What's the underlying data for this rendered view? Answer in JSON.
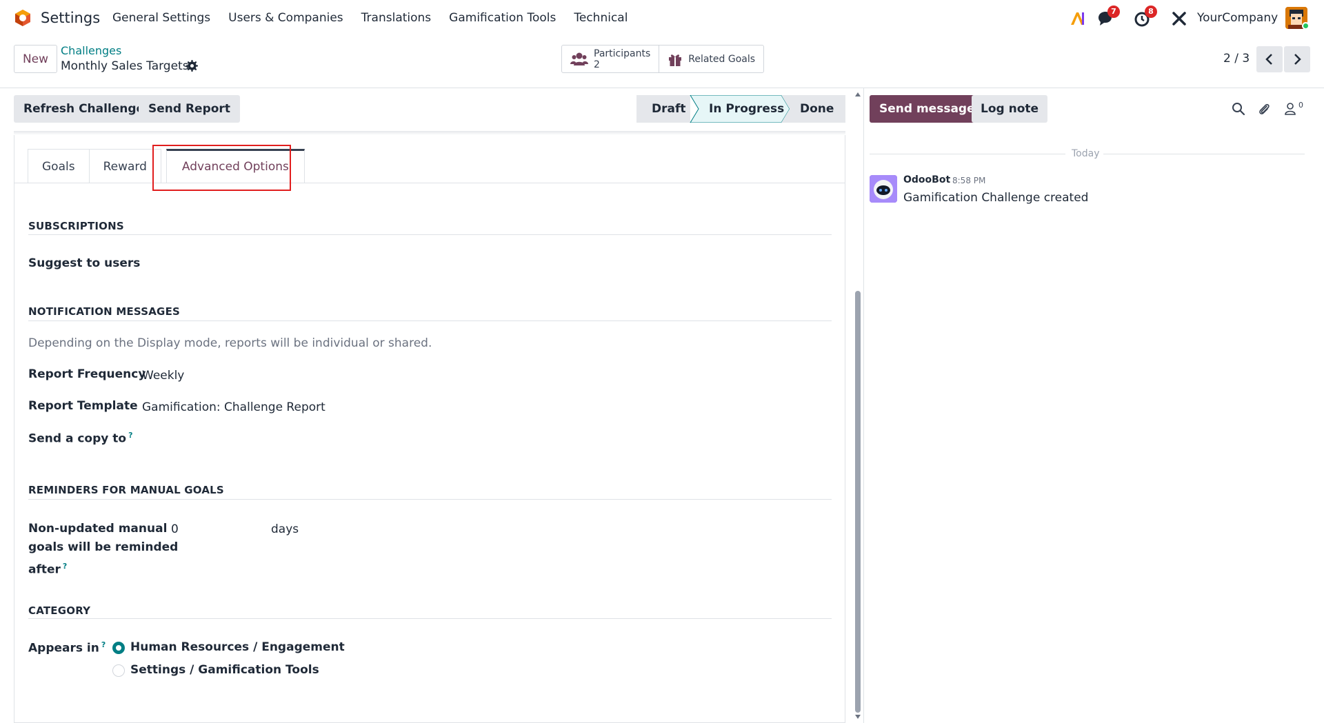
{
  "navbar": {
    "app_name": "Settings",
    "menu": [
      "General Settings",
      "Users & Companies",
      "Translations",
      "Gamification Tools",
      "Technical"
    ],
    "messages_badge": "7",
    "activities_badge": "8",
    "company": "YourCompany",
    "icons": [
      "odoo-logo-icon",
      "ai-icon",
      "chat-icon",
      "clock-icon",
      "tools-icon"
    ]
  },
  "control_panel": {
    "new_label": "New",
    "breadcrumb_parent": "Challenges",
    "breadcrumb_current": "Monthly Sales Targets",
    "smart_buttons": {
      "participants_label": "Participants",
      "participants_count": "2",
      "related_goals_label": "Related Goals"
    },
    "pager": "2 / 3"
  },
  "statusbar": {
    "refresh_label": "Refresh Challenge",
    "send_report_label": "Send Report",
    "stages": [
      "Draft",
      "In Progress",
      "Done"
    ],
    "active_stage": "In Progress"
  },
  "form": {
    "tabs": [
      "Goals",
      "Reward",
      "Advanced Options"
    ],
    "active_tab": "Advanced Options",
    "subscriptions": {
      "title": "SUBSCRIPTIONS",
      "suggest_label": "Suggest to users"
    },
    "notifications": {
      "title": "NOTIFICATION MESSAGES",
      "hint": "Depending on the Display mode, reports will be individual or shared.",
      "frequency_label": "Report Frequency",
      "frequency_value": "Weekly",
      "template_label": "Report Template",
      "template_value": "Gamification: Challenge Report",
      "copy_label": "Send a copy to",
      "help_mark": "?"
    },
    "reminders": {
      "title": "REMINDERS FOR MANUAL GOALS",
      "label_line1": "Non-updated manual",
      "label_line2": "goals will be reminded",
      "label_line3": "after",
      "value": "0",
      "unit": "days"
    },
    "category": {
      "title": "CATEGORY",
      "appears_label": "Appears in",
      "options": [
        "Human Resources / Engagement",
        "Settings / Gamification Tools"
      ],
      "selected": "Human Resources / Engagement"
    }
  },
  "chatter": {
    "send_message_label": "Send message",
    "log_note_label": "Log note",
    "follower_count": "0",
    "date_separator": "Today",
    "messages": [
      {
        "author": "OdooBot",
        "time": "8:58 PM",
        "body": "Gamification Challenge created"
      }
    ]
  },
  "colors": {
    "brand": "#71405b",
    "link": "#017e84",
    "highlight": "#e11d1d",
    "badge": "#dc2626"
  }
}
